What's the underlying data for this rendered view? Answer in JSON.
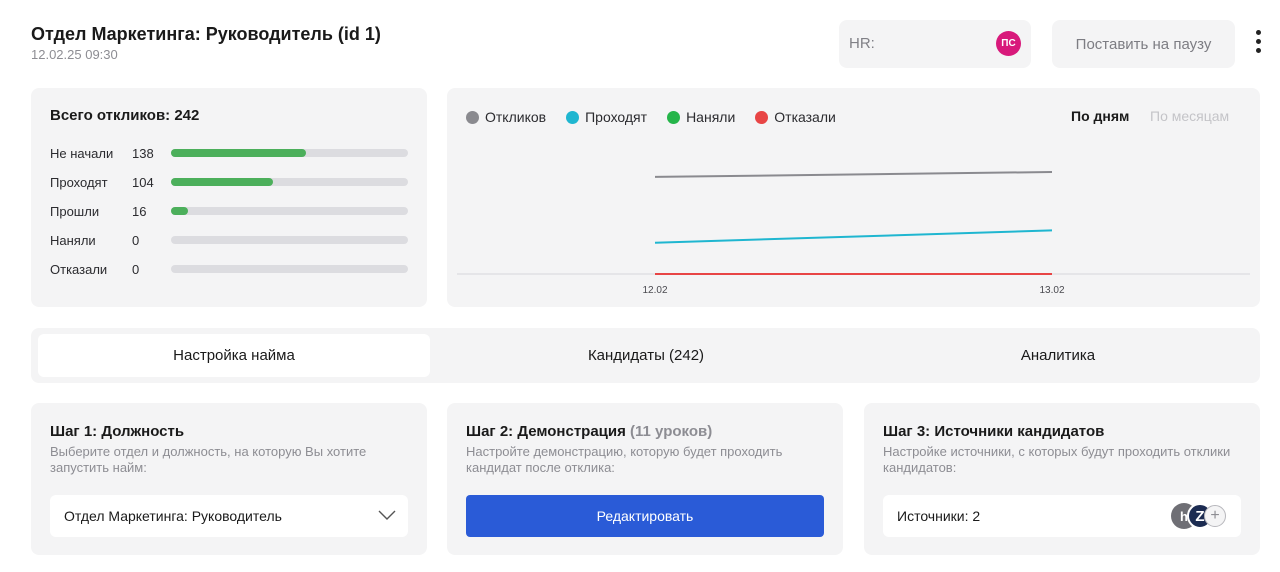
{
  "header": {
    "title": "Отдел Маркетинга: Руководитель (id 1)",
    "datetime": "12.02.25 09:30",
    "hr_label": "HR:",
    "hr_avatar_initials": "ПС",
    "pause_label": "Поставить на паузу",
    "more_icon": "vertical-dots-icon"
  },
  "stats": {
    "title": "Всего откликов: 242",
    "rows": [
      {
        "label": "Не начали",
        "value": "138",
        "fraction": 0.57
      },
      {
        "label": "Проходят",
        "value": "104",
        "fraction": 0.43
      },
      {
        "label": "Прошли",
        "value": "16",
        "fraction": 0.07
      },
      {
        "label": "Наняли",
        "value": "0",
        "fraction": 0
      },
      {
        "label": "Отказали",
        "value": "0",
        "fraction": 0
      }
    ],
    "bar_color": "#4caf5b"
  },
  "chart": {
    "period_days": "По дням",
    "period_months": "По месяцам"
  },
  "chart_data": {
    "type": "line",
    "x": [
      "12.02",
      "13.02"
    ],
    "series": [
      {
        "name": "Откликов",
        "color": "#8a8a8f",
        "values": [
          118,
          124
        ]
      },
      {
        "name": "Проходят",
        "color": "#1fb6d0",
        "values": [
          38,
          53
        ]
      },
      {
        "name": "Наняли",
        "color": "#26b54a",
        "values": [
          0,
          0
        ]
      },
      {
        "name": "Отказали",
        "color": "#e84545",
        "values": [
          0,
          0
        ]
      }
    ],
    "ylim": [
      0,
      124
    ],
    "grid": false
  },
  "tabs": [
    {
      "label": "Настройка найма",
      "active": true
    },
    {
      "label": "Кандидаты (242)",
      "active": false
    },
    {
      "label": "Аналитика",
      "active": false
    }
  ],
  "steps": {
    "step1": {
      "title": "Шаг 1: Должность",
      "desc": "Выберите отдел и должность, на которую Вы хотите запустить найм:",
      "selected": "Отдел Маркетинга: Руководитель"
    },
    "step2": {
      "title": "Шаг 2: Демонстрация",
      "title_muted": "(11 уроков)",
      "desc": "Настройте демонстрацию, которую будет проходить кандидат после отклика:",
      "button": "Редактировать"
    },
    "step3": {
      "title": "Шаг 3: Источники кандидатов",
      "desc": "Настройке источники, с которых будут проходить отклики кандидатов:",
      "sources_label": "Источники: 2",
      "source_icons": [
        "hh-icon",
        "z-icon",
        "add-circle-icon"
      ]
    }
  }
}
